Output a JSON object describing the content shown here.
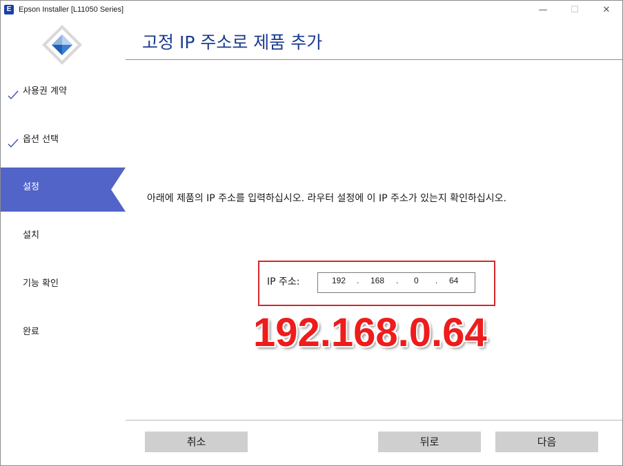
{
  "window": {
    "title": "Epson Installer [L11050 Series]",
    "app_icon_letter": "E",
    "minimize_glyph": "—",
    "maximize_glyph": "☐",
    "close_glyph": "✕"
  },
  "sidebar": {
    "logo_icon": "diamond-logo-icon",
    "steps": [
      {
        "label": "사용권 계약",
        "state": "done"
      },
      {
        "label": "옵션 선택",
        "state": "done"
      },
      {
        "label": "설정",
        "state": "active"
      },
      {
        "label": "설치",
        "state": "pending"
      },
      {
        "label": "기능 확인",
        "state": "pending"
      },
      {
        "label": "완료",
        "state": "pending"
      }
    ]
  },
  "main": {
    "title": "고정 IP 주소로 제품 추가",
    "instruction": "아래에 제품의 IP 주소를 입력하십시오. 라우터 설정에 이 IP 주소가 있는지 확인하십시오.",
    "ip_label": "IP 주소:",
    "ip_octets": [
      "192",
      "168",
      "0",
      "64"
    ],
    "ip_separator": ".",
    "annotation": "192.168.0.64"
  },
  "buttons": {
    "cancel": "취소",
    "back": "뒤로",
    "next": "다음"
  },
  "colors": {
    "accent": "#5264c8",
    "title": "#1a3b8f",
    "highlight_border": "#d4262a",
    "annotation": "#ee1c1c",
    "button_bg": "#cfcfcf"
  }
}
